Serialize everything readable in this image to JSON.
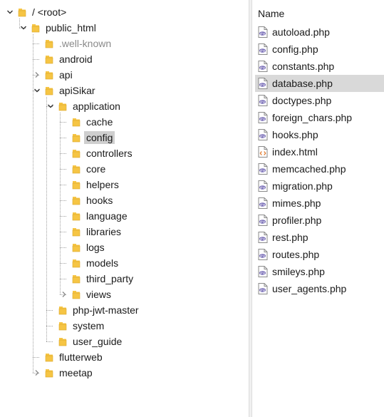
{
  "tree": [
    {
      "label": "/ <root>",
      "expanded": true
    },
    {
      "label": "public_html",
      "expanded": true
    },
    {
      "label": ".well-known"
    },
    {
      "label": "android"
    },
    {
      "label": "api",
      "expanded": false
    },
    {
      "label": "apiSikar",
      "expanded": true
    },
    {
      "label": "application",
      "expanded": true
    },
    {
      "label": "cache"
    },
    {
      "label": "config",
      "selected": true
    },
    {
      "label": "controllers"
    },
    {
      "label": "core"
    },
    {
      "label": "helpers"
    },
    {
      "label": "hooks"
    },
    {
      "label": "language"
    },
    {
      "label": "libraries"
    },
    {
      "label": "logs"
    },
    {
      "label": "models"
    },
    {
      "label": "third_party"
    },
    {
      "label": "views",
      "expanded": false
    },
    {
      "label": "php-jwt-master"
    },
    {
      "label": "system"
    },
    {
      "label": "user_guide"
    },
    {
      "label": "flutterweb"
    },
    {
      "label": "meetap",
      "expanded": false
    }
  ],
  "file_list": {
    "column_name": "Name",
    "files": [
      {
        "name": "autoload.php",
        "icon": "php-file-icon"
      },
      {
        "name": "config.php",
        "icon": "php-file-icon"
      },
      {
        "name": "constants.php",
        "icon": "php-file-icon"
      },
      {
        "name": "database.php",
        "icon": "php-file-icon",
        "selected": true
      },
      {
        "name": "doctypes.php",
        "icon": "php-file-icon"
      },
      {
        "name": "foreign_chars.php",
        "icon": "php-file-icon"
      },
      {
        "name": "hooks.php",
        "icon": "php-file-icon"
      },
      {
        "name": "index.html",
        "icon": "html-file-icon"
      },
      {
        "name": "memcached.php",
        "icon": "php-file-icon"
      },
      {
        "name": "migration.php",
        "icon": "php-file-icon"
      },
      {
        "name": "mimes.php",
        "icon": "php-file-icon"
      },
      {
        "name": "profiler.php",
        "icon": "php-file-icon"
      },
      {
        "name": "rest.php",
        "icon": "php-file-icon"
      },
      {
        "name": "routes.php",
        "icon": "php-file-icon"
      },
      {
        "name": "smileys.php",
        "icon": "php-file-icon"
      },
      {
        "name": "user_agents.php",
        "icon": "php-file-icon"
      }
    ]
  },
  "colors": {
    "folder": "#f6c544",
    "selection": "#cfcfcf",
    "php_icon": "#7a6fb8",
    "html_icon": "#e07a2e"
  }
}
